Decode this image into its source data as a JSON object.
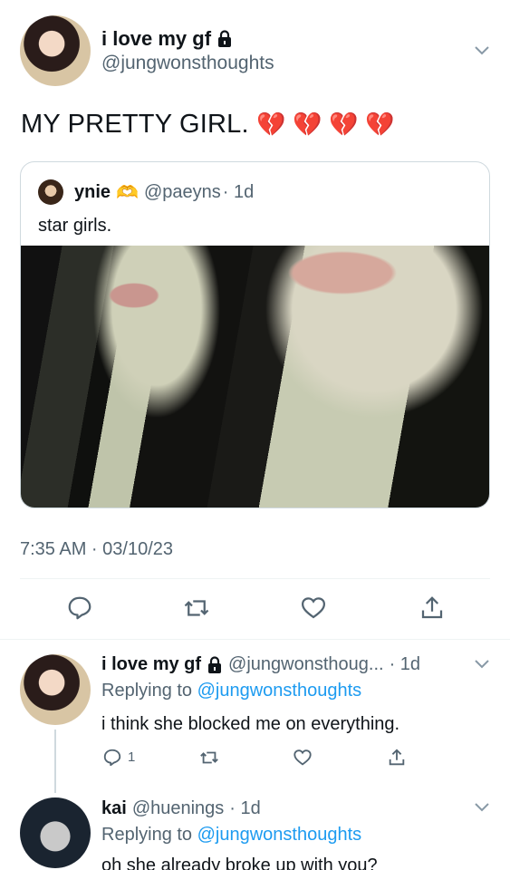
{
  "main_tweet": {
    "display_name": "i love my gf",
    "handle": "@jungwonsthoughts",
    "text": "MY PRETTY GIRL.",
    "emojis": "💔 💔 💔 💔",
    "timestamp": "7:35 AM · 03/10/23"
  },
  "quote": {
    "display_name": "ynie",
    "badge_emoji": "🫶",
    "handle": "@paeyns",
    "time": "· 1d",
    "text": "star girls."
  },
  "replies": [
    {
      "display_name": "i love my gf",
      "handle": "@jungwonsthoug...",
      "time": "· 1d",
      "replying_prefix": "Replying to",
      "replying_to": "@jungwonsthoughts",
      "text": "i think she blocked me on everything.",
      "reply_count": "1"
    },
    {
      "display_name": "kai",
      "handle": "@huenings",
      "time": "· 1d",
      "replying_prefix": "Replying to",
      "replying_to": "@jungwonsthoughts",
      "text": "oh she already broke up with you?"
    }
  ],
  "colors": {
    "accent": "#1d9bf0",
    "muted": "#536471",
    "border": "#cfd9de"
  },
  "icons": [
    "lock-icon",
    "chevron-down-icon",
    "reply-icon",
    "retweet-icon",
    "like-icon",
    "share-icon"
  ]
}
